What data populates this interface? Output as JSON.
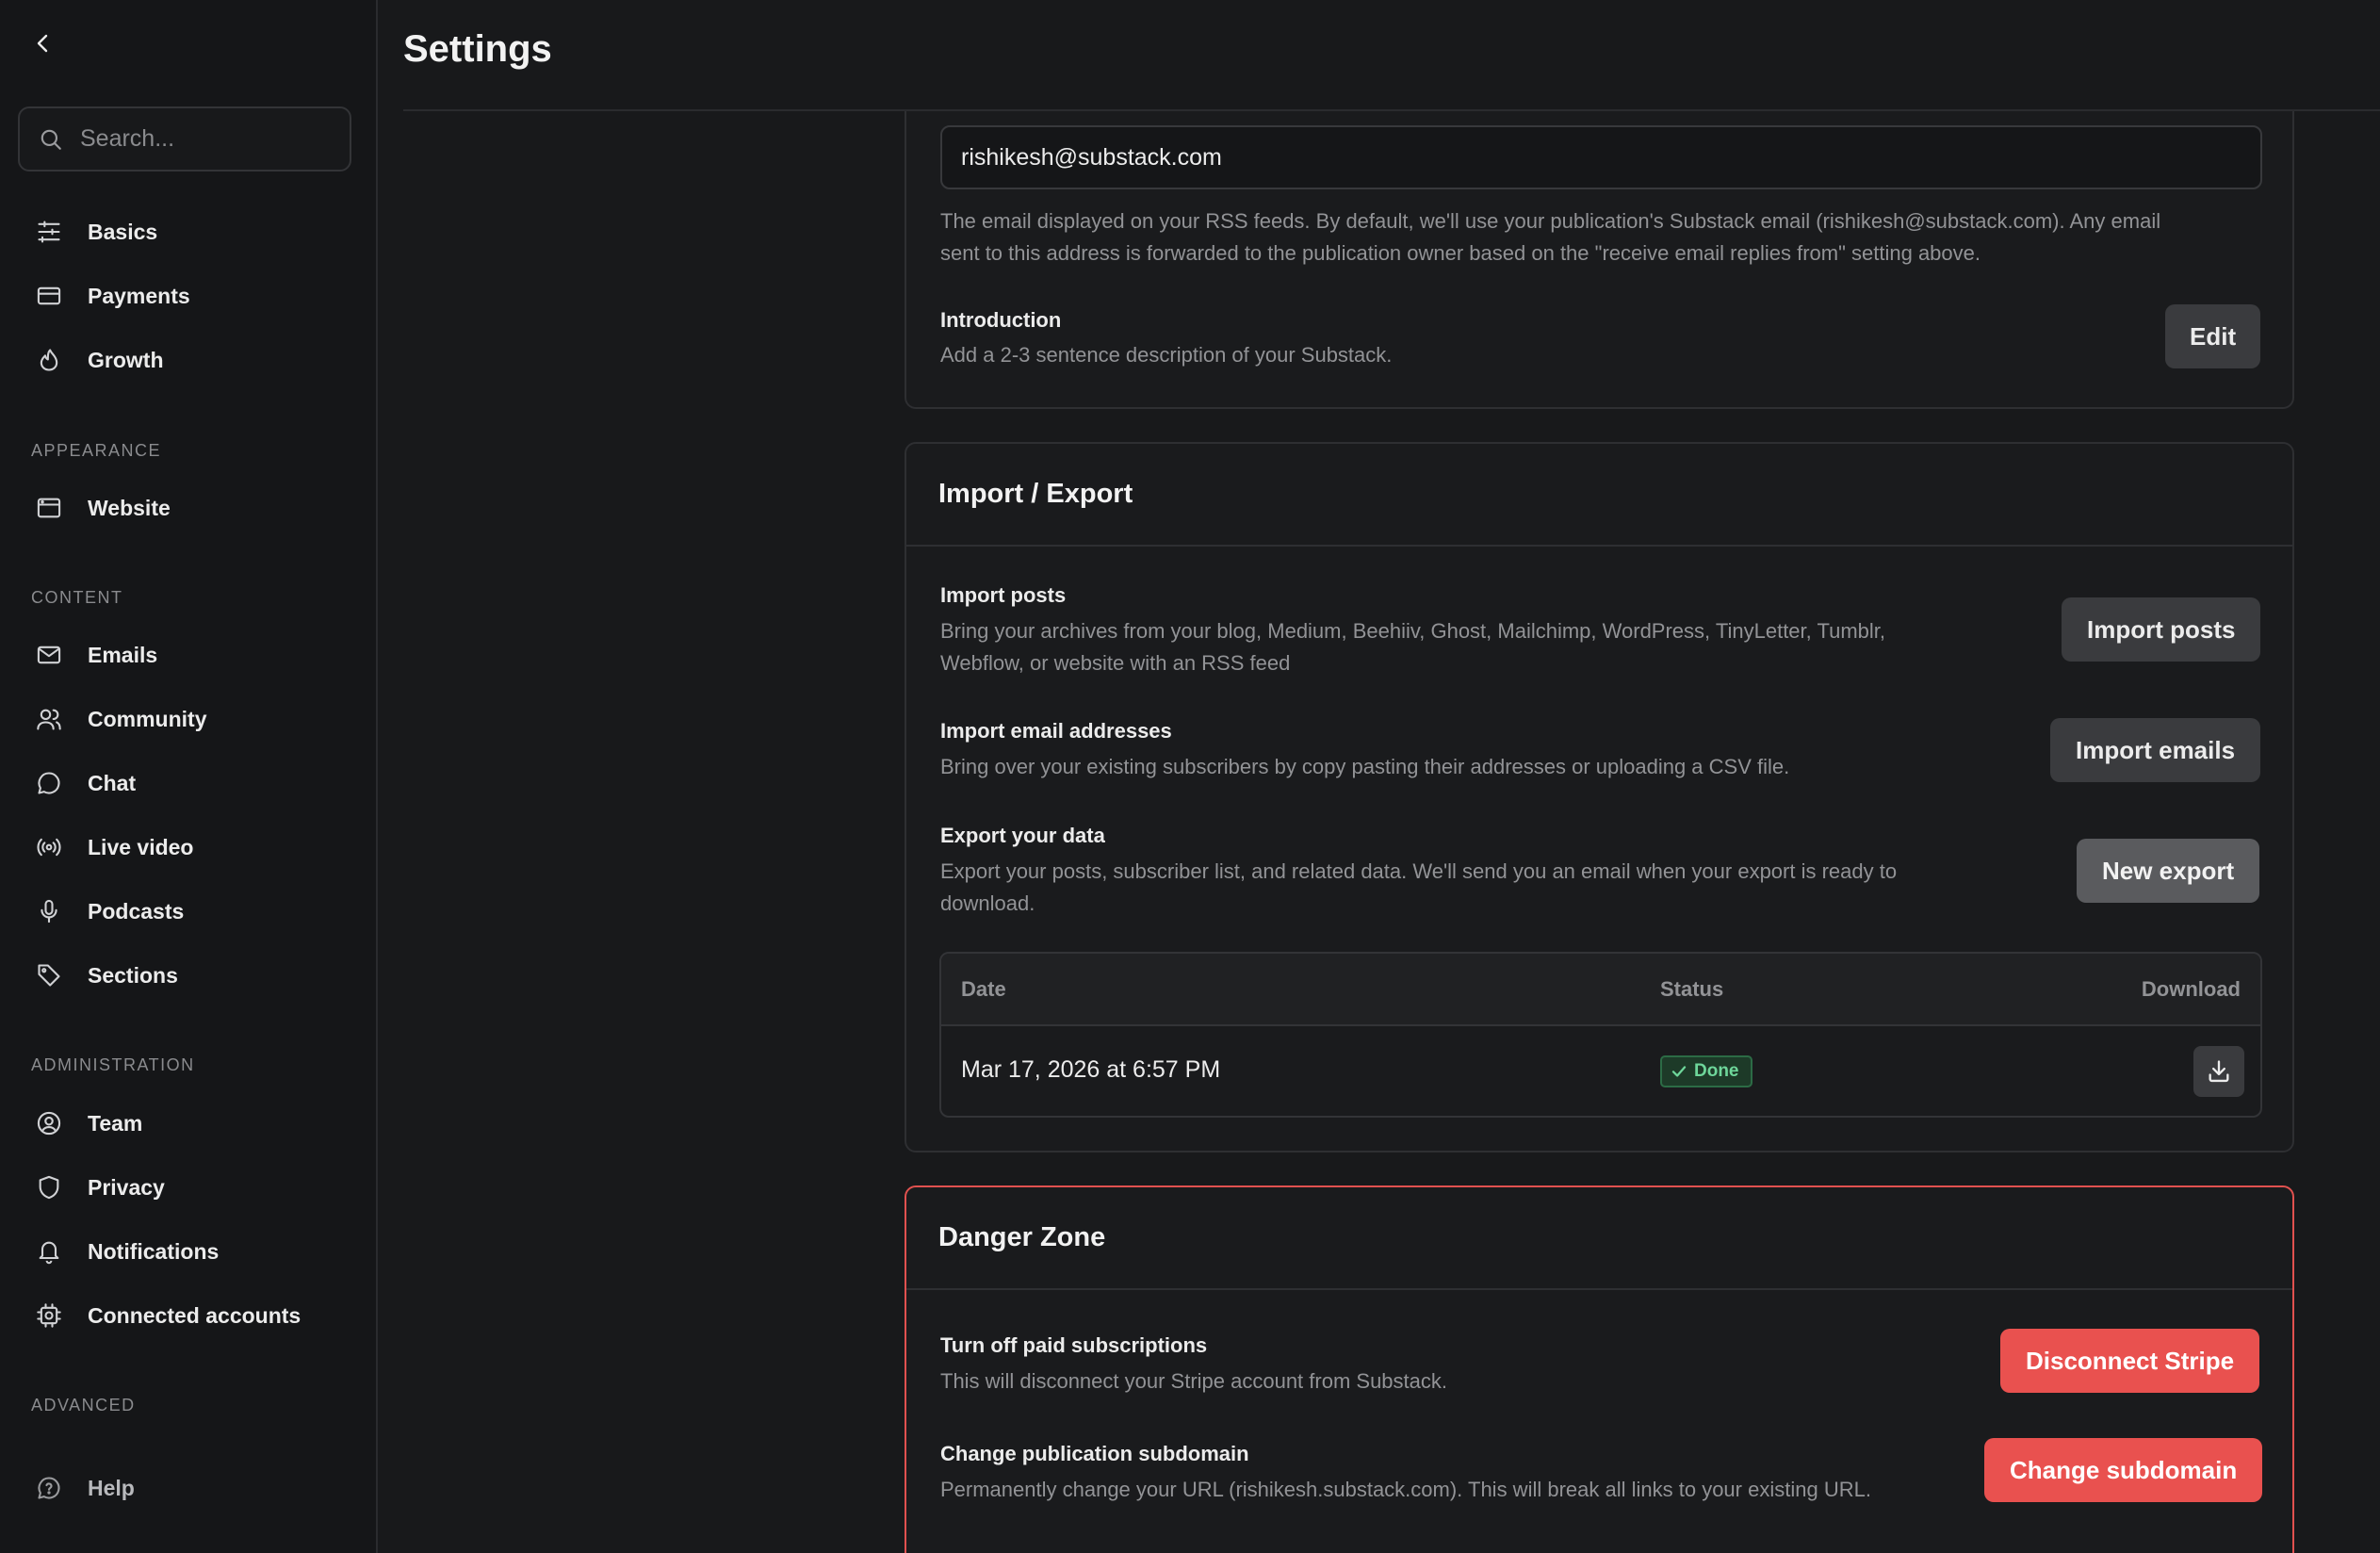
{
  "sidebar": {
    "search_placeholder": "Search...",
    "top_items": [
      {
        "label": "Basics",
        "icon": "sliders-icon"
      },
      {
        "label": "Payments",
        "icon": "credit-card-icon"
      },
      {
        "label": "Growth",
        "icon": "flame-icon"
      }
    ],
    "sections": {
      "appearance": "APPEARANCE",
      "content": "CONTENT",
      "administration": "ADMINISTRATION",
      "advanced": "ADVANCED"
    },
    "appearance_items": [
      {
        "label": "Website",
        "icon": "browser-window-icon"
      }
    ],
    "content_items": [
      {
        "label": "Emails",
        "icon": "mail-icon"
      },
      {
        "label": "Community",
        "icon": "users-icon"
      },
      {
        "label": "Chat",
        "icon": "chat-bubble-icon"
      },
      {
        "label": "Live video",
        "icon": "broadcast-icon"
      },
      {
        "label": "Podcasts",
        "icon": "microphone-icon"
      },
      {
        "label": "Sections",
        "icon": "tag-icon"
      }
    ],
    "admin_items": [
      {
        "label": "Team",
        "icon": "user-circle-icon"
      },
      {
        "label": "Privacy",
        "icon": "shield-icon"
      },
      {
        "label": "Notifications",
        "icon": "bell-icon"
      },
      {
        "label": "Connected accounts",
        "icon": "chip-icon"
      }
    ],
    "advanced_items": [
      {
        "label": "Help",
        "icon": "help-bubble-icon"
      }
    ]
  },
  "header": {
    "title": "Settings"
  },
  "rss_card": {
    "email_value": "rishikesh@substack.com",
    "email_help_line1": "The email displayed on your RSS feeds. By default, we'll use your publication's Substack email (rishikesh@substack.com). Any email",
    "email_help_line2": "sent to this address is forwarded to the publication owner based on the \"receive email replies from\" setting above.",
    "intro_title": "Introduction",
    "intro_desc": "Add a 2-3 sentence description of your Substack.",
    "edit_label": "Edit"
  },
  "import_export": {
    "title": "Import / Export",
    "import_posts_title": "Import posts",
    "import_posts_desc_line1": "Bring your archives from your blog, Medium, Beehiiv, Ghost, Mailchimp, WordPress, TinyLetter, Tumblr,",
    "import_posts_desc_line2": "Webflow, or website with an RSS feed",
    "import_posts_btn": "Import posts",
    "import_emails_title": "Import email addresses",
    "import_emails_desc": "Bring over your existing subscribers by copy pasting their addresses or uploading a CSV file.",
    "import_emails_btn": "Import emails",
    "export_title": "Export your data",
    "export_desc_line1": "Export your posts, subscriber list, and related data. We'll send you an email when your export is ready to",
    "export_desc_line2": "download.",
    "export_btn": "New export",
    "table": {
      "col_date": "Date",
      "col_status": "Status",
      "col_download": "Download",
      "rows": [
        {
          "date": "Mar 17, 2026 at 6:57 PM",
          "status": "Done"
        }
      ]
    }
  },
  "danger_zone": {
    "title": "Danger Zone",
    "stripe_title": "Turn off paid subscriptions",
    "stripe_desc": "This will disconnect your Stripe account from Substack.",
    "stripe_btn": "Disconnect Stripe",
    "subdomain_title": "Change publication subdomain",
    "subdomain_desc": "Permanently change your URL (rishikesh.substack.com). This will break all links to your existing URL.",
    "subdomain_btn": "Change subdomain"
  },
  "colors": {
    "accent_red": "#e9514f",
    "success_green": "#6ed69a",
    "background": "#18191b"
  }
}
